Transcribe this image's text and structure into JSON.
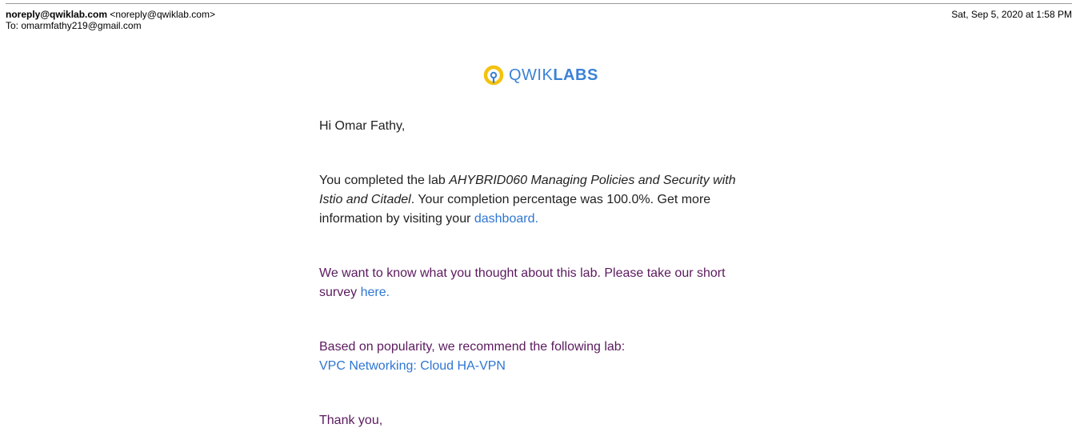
{
  "email": {
    "from_name": "noreply@qwiklab.com",
    "from_address": "<noreply@qwiklab.com>",
    "to_label": "To:",
    "to_address": "omarmfathy219@gmail.com",
    "date": "Sat, Sep 5, 2020 at 1:58 PM"
  },
  "logo": {
    "text_light": "QWIK",
    "text_bold": "LABS",
    "icon": "qwiklabs-logo-icon",
    "ring_color": "#f4c20d",
    "text_color": "#3b82d6"
  },
  "body": {
    "greeting": "Hi Omar Fathy,",
    "completed_prefix": "You completed the lab ",
    "lab_name": "AHYBRID060 Managing Policies and Security with Istio and Citadel",
    "completed_suffix": ". Your completion percentage was 100.0%. Get more information by visiting your ",
    "dashboard_link": "dashboard",
    "dashboard_end": ".",
    "survey_prefix": "We want to know what you thought about this lab. Please take our short survey ",
    "survey_link": "here",
    "survey_end": ".",
    "recommend_text": "Based on popularity, we recommend the following lab:",
    "recommend_link": "VPC Networking: Cloud HA-VPN",
    "thanks": "Thank you,"
  },
  "colors": {
    "link": "#2f76d2",
    "purple_text": "#5b1a5e",
    "body_text": "#222222"
  }
}
